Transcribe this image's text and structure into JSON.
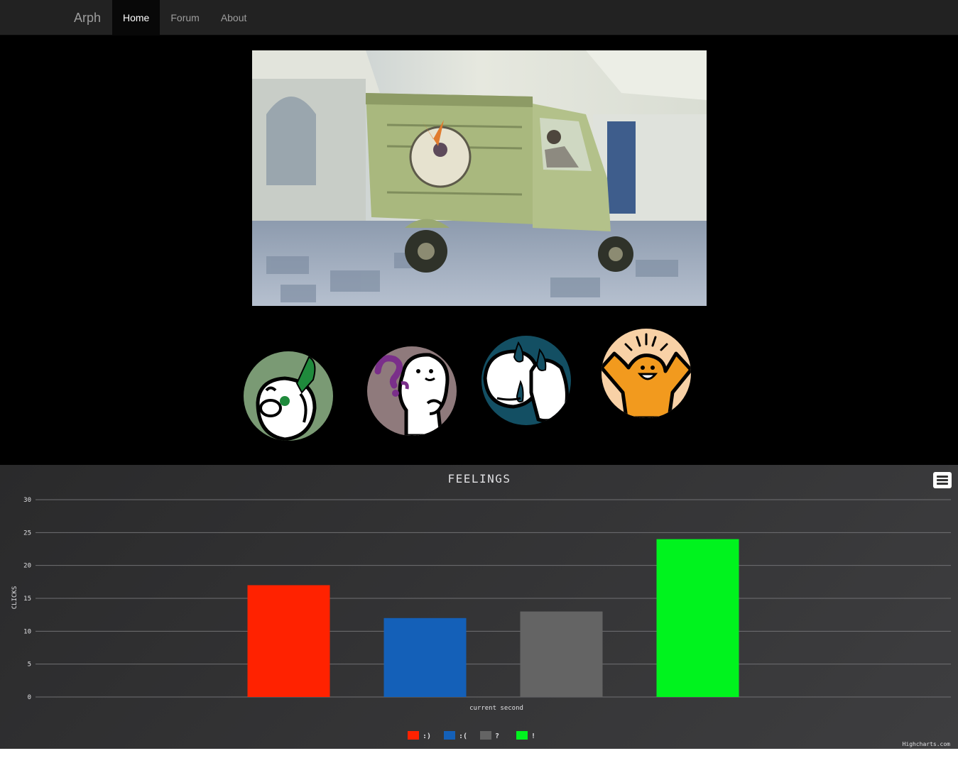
{
  "nav": {
    "brand": "Arph",
    "items": [
      {
        "label": "Home",
        "active": true
      },
      {
        "label": "Forum",
        "active": false
      },
      {
        "label": "About",
        "active": false
      }
    ]
  },
  "video": {
    "icon": "video-frame"
  },
  "emotions": [
    {
      "name": "surprise",
      "icon": "exclamation-face-icon",
      "color": "#7a9a74",
      "accent": "#1f8a3c"
    },
    {
      "name": "confused",
      "icon": "question-face-icon",
      "color": "#8f7a7c",
      "accent": "#7a2f8a"
    },
    {
      "name": "sad",
      "icon": "sad-face-icon",
      "color": "#134f63",
      "accent": "#134f63"
    },
    {
      "name": "happy",
      "icon": "happy-face-icon",
      "color": "#f8d1a6",
      "accent": "#f29a1e"
    }
  ],
  "chart_data": {
    "type": "bar",
    "title": "FEELINGS",
    "xlabel": "current second",
    "ylabel": "CLICKS",
    "ylim": [
      0,
      30
    ],
    "yticks": [
      0,
      5,
      10,
      15,
      20,
      25,
      30
    ],
    "grid": true,
    "legend_position": "bottom-center",
    "series": [
      {
        "name": ":)",
        "values": [
          17
        ],
        "color": "#ff2200"
      },
      {
        "name": ":(",
        "values": [
          12
        ],
        "color": "#1460b8"
      },
      {
        "name": "?",
        "values": [
          13
        ],
        "color": "#646464"
      },
      {
        "name": "!",
        "values": [
          24
        ],
        "color": "#00f31e"
      }
    ],
    "credit": "Highcharts.com"
  }
}
